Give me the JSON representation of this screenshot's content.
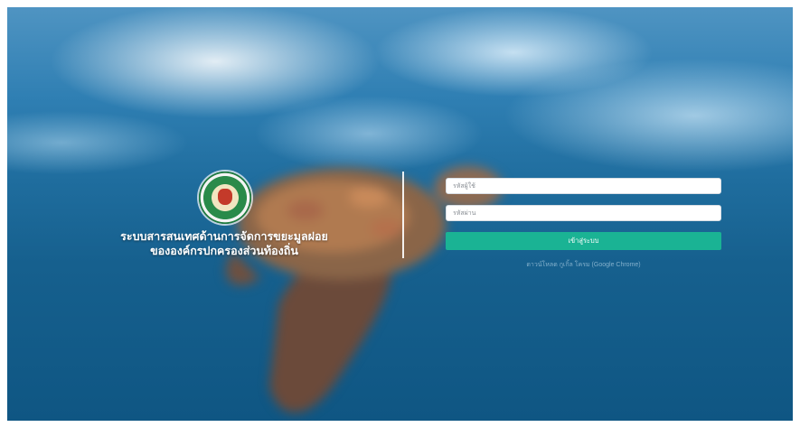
{
  "brand": {
    "title_line1": "ระบบสารสนเทศด้านการจัดการขยะมูลฝอย",
    "title_line2": "ขององค์กรปกครองส่วนท้องถิ่น",
    "logo_icon": "department-emblem-icon"
  },
  "login": {
    "username_placeholder": "รหัสผู้ใช้",
    "password_placeholder": "รหัสผ่าน",
    "submit_label": "เข้าสู่ระบบ",
    "download_link": "ดาวน์โหลด กูเกิ้ล โครม (Google Chrome)"
  },
  "colors": {
    "accent": "#1ab394",
    "ocean": "#16608e"
  }
}
